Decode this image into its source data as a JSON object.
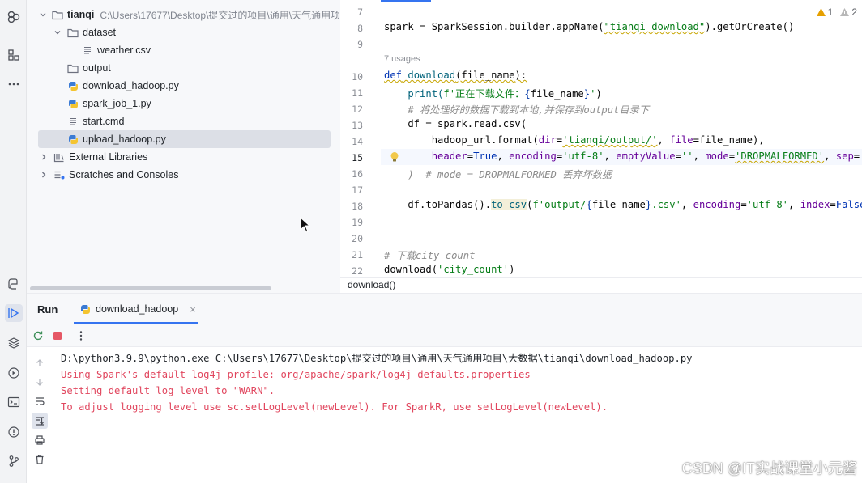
{
  "project_tree": {
    "root": {
      "name": "tianqi",
      "path": "C:\\Users\\17677\\Desktop\\提交过的项目\\通用\\天气通用项"
    },
    "items": [
      {
        "label": "dataset",
        "type": "folder"
      },
      {
        "label": "weather.csv",
        "type": "text-file"
      },
      {
        "label": "output",
        "type": "folder"
      },
      {
        "label": "download_hadoop.py",
        "type": "python-file"
      },
      {
        "label": "spark_job_1.py",
        "type": "python-file"
      },
      {
        "label": "start.cmd",
        "type": "text-file"
      },
      {
        "label": "upload_hadoop.py",
        "type": "python-file",
        "selected": true
      },
      {
        "label": "External Libraries",
        "type": "library"
      },
      {
        "label": "Scratches and Consoles",
        "type": "scratch"
      }
    ]
  },
  "editor": {
    "inspections": {
      "warnings": "1",
      "weak_warnings": "2"
    },
    "usages_hint": "7 usages",
    "line_numbers": [
      "7",
      "8",
      "9",
      "10",
      "11",
      "12",
      "13",
      "14",
      "15",
      "16",
      "17",
      "18",
      "19",
      "20",
      "21",
      "22"
    ],
    "current_line": "15",
    "code": {
      "l8": [
        "spark = SparkSession.builder.appName(",
        "\"tianqi_download\"",
        ").getOrCreate()"
      ],
      "l10": [
        "def",
        " ",
        "download",
        "(",
        "file_name",
        "):"
      ],
      "l11": [
        "    print(",
        "f'正在下载文件：",
        "{",
        "file_name",
        "}",
        "'",
        ")"
      ],
      "l12": "    # 将处理好的数据下载到本地,并保存到output目录下",
      "l13": "    df = spark.read.csv(",
      "l14": [
        "        hadoop_url.format(",
        "dir",
        "=",
        "'tianqi/output/'",
        ", ",
        "file",
        "=file_name),"
      ],
      "l15": [
        "        ",
        "header",
        "=",
        "True",
        ", ",
        "encoding",
        "=",
        "'utf-8'",
        ", ",
        "emptyValue",
        "=",
        "''",
        ", ",
        "mode",
        "=",
        "'DROPMALFORMED'",
        ", ",
        "sep",
        "=",
        "'"
      ],
      "l16": "    )  # mode = DROPMALFORMED 丢弃坏数据",
      "l18": [
        "    df.toPandas().",
        "to_csv",
        "(",
        "f'output/",
        "{",
        "file_name",
        "}",
        ".csv'",
        ", ",
        "encoding",
        "=",
        "'utf-8'",
        ", ",
        "index",
        "=",
        "False"
      ],
      "l21": "# 下载city_count",
      "l22": [
        "download(",
        "'city_count'",
        ")"
      ]
    },
    "breadcrumb": "download()"
  },
  "run_panel": {
    "title": "Run",
    "tab_label": "download_hadoop",
    "tab_close": "×",
    "console": {
      "command": "D:\\python3.9.9\\python.exe C:\\Users\\17677\\Desktop\\提交过的项目\\通用\\天气通用项目\\大数据\\tianqi\\download_hadoop.py",
      "errors": [
        "Using Spark's default log4j profile: org/apache/spark/log4j-defaults.properties",
        "Setting default log level to \"WARN\".",
        "To adjust logging level use sc.setLogLevel(newLevel). For SparkR, use setLogLevel(newLevel)."
      ]
    }
  },
  "watermark": "CSDN @IT实战课堂小元酱",
  "colors": {
    "accent": "#3574f0",
    "error": "#e1465e",
    "keyword": "#0033b3",
    "string": "#067d17"
  }
}
